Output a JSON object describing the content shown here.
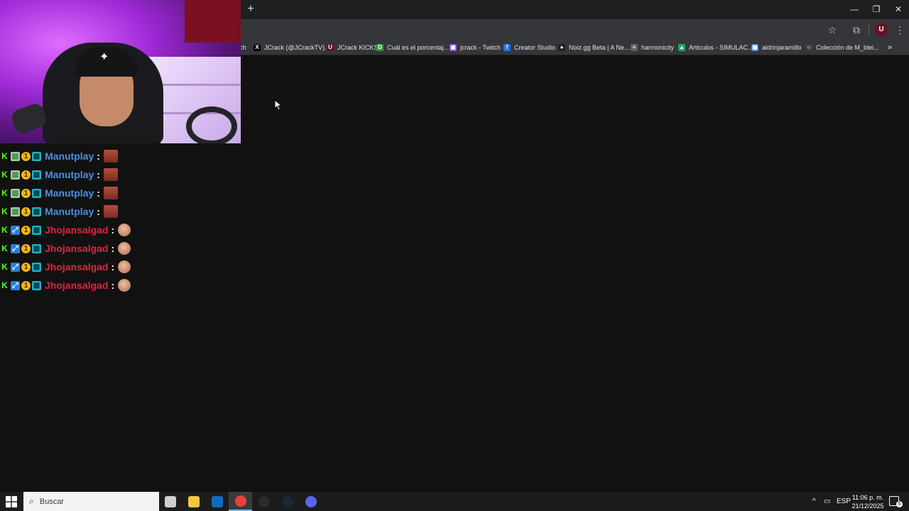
{
  "browser": {
    "new_tab_glyph": "+",
    "window_controls": {
      "minimize": "—",
      "maximize": "❐",
      "close": "✕"
    },
    "toolbar": {
      "star_icon": "☆",
      "extensions_icon": "⧉",
      "profile_initial": "U",
      "menu_icon": "⋮"
    },
    "bookmarks": [
      {
        "label": "ch",
        "icon": "",
        "color": "#35363a"
      },
      {
        "label": "JCrack (@JCrackTV)...",
        "icon": "X",
        "color": "#000000"
      },
      {
        "label": "JCrack KICKS",
        "icon": "U",
        "color": "#6d0f24"
      },
      {
        "label": "Cuál es el porcentaj...",
        "icon": "D",
        "color": "#2e9e3a"
      },
      {
        "label": "jcrack - Twitch",
        "icon": "▣",
        "color": "#9146ff"
      },
      {
        "label": "Creator Studio",
        "icon": "f",
        "color": "#1877f2"
      },
      {
        "label": "Noiz.gg Beta | A Ne...",
        "icon": "●",
        "color": "#222222"
      },
      {
        "label": "harmonicity",
        "icon": "≡",
        "color": "#5f6368"
      },
      {
        "label": "Artículos - SIMULAC...",
        "icon": "▲",
        "color": "#1fa463"
      },
      {
        "label": "aldrinjaramillo",
        "icon": "▦",
        "color": "#4285f4"
      },
      {
        "label": "Colección de M_blei...",
        "icon": "○",
        "color": "#3c4043"
      }
    ],
    "more_bookmarks": "»"
  },
  "chat": {
    "messages": [
      {
        "username": "Manutplay",
        "color": "#4a90e2",
        "badge_type": "a",
        "emote": "box"
      },
      {
        "username": "Manutplay",
        "color": "#4a90e2",
        "badge_type": "a",
        "emote": "box"
      },
      {
        "username": "Manutplay",
        "color": "#4a90e2",
        "badge_type": "a",
        "emote": "box"
      },
      {
        "username": "Manutplay",
        "color": "#4a90e2",
        "badge_type": "a",
        "emote": "box"
      },
      {
        "username": "Jhojansalgad",
        "color": "#e0243a",
        "badge_type": "b",
        "emote": "round"
      },
      {
        "username": "Jhojansalgad",
        "color": "#e0243a",
        "badge_type": "b",
        "emote": "round"
      },
      {
        "username": "Jhojansalgad",
        "color": "#e0243a",
        "badge_type": "b",
        "emote": "round"
      },
      {
        "username": "Jhojansalgad",
        "color": "#e0243a",
        "badge_type": "b",
        "emote": "round"
      }
    ],
    "separator": ":",
    "badge_k": "K",
    "badge_sub": "1"
  },
  "taskbar": {
    "search_placeholder": "Buscar",
    "apps": [
      {
        "name": "task-view",
        "color": "#cfcfcf"
      },
      {
        "name": "file-explorer",
        "color": "#f4c542"
      },
      {
        "name": "outlook",
        "color": "#0f6cbd"
      },
      {
        "name": "chrome",
        "color": "#e94235"
      },
      {
        "name": "obs",
        "color": "#2b2b2b"
      },
      {
        "name": "steam",
        "color": "#1b2838"
      },
      {
        "name": "discord",
        "color": "#5865f2"
      }
    ],
    "active_app_index": 3,
    "tray_chevron": "^",
    "language": "ESP",
    "time": "11:06 p. m.",
    "date": "21/12/2025",
    "notification_count": "5"
  }
}
